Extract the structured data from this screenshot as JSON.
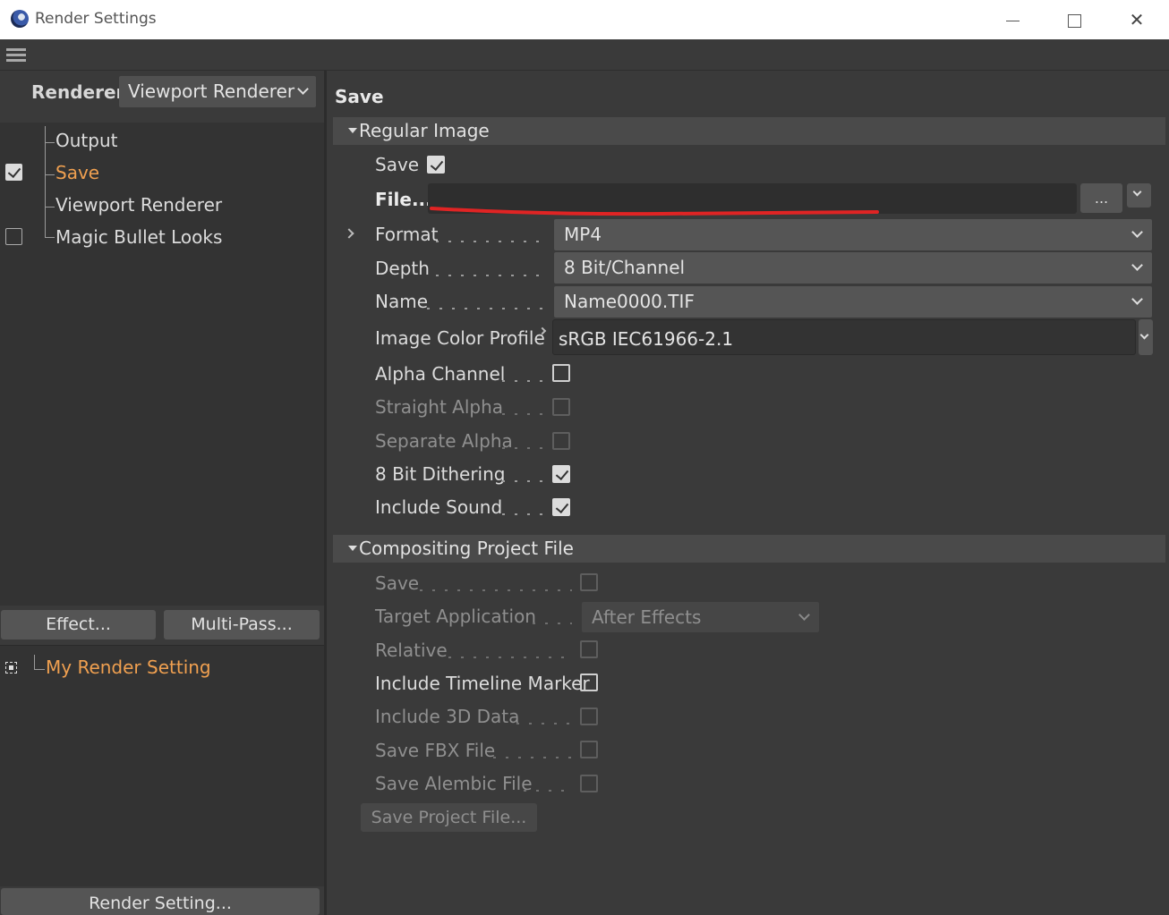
{
  "window": {
    "title": "Render Settings"
  },
  "left": {
    "renderer_label": "Renderer",
    "renderer_value": "Viewport Renderer",
    "tree": [
      {
        "label": "Output",
        "checked": null,
        "active": false
      },
      {
        "label": "Save",
        "checked": true,
        "active": true
      },
      {
        "label": "Viewport Renderer",
        "checked": null,
        "active": false
      },
      {
        "label": "Magic Bullet Looks",
        "checked": false,
        "active": false
      }
    ],
    "effect_button": "Effect...",
    "multipass_button": "Multi-Pass...",
    "render_setting_name": "My Render Setting",
    "render_setting_button": "Render Setting..."
  },
  "right": {
    "section_title": "Save",
    "regular_image": {
      "header": "Regular Image",
      "save_label": "Save",
      "save_checked": true,
      "file_label": "File...",
      "file_value": "",
      "browse_label": "...",
      "format_label": "Format",
      "format_value": "MP4",
      "depth_label": "Depth",
      "depth_value": "8 Bit/Channel",
      "name_label": "Name",
      "name_value": "Name0000.TIF",
      "color_profile_label": "Image Color Profile",
      "color_profile_value": "sRGB IEC61966-2.1",
      "alpha_channel_label": "Alpha Channel",
      "alpha_channel_checked": false,
      "straight_alpha_label": "Straight Alpha",
      "straight_alpha_checked": false,
      "separate_alpha_label": "Separate Alpha",
      "separate_alpha_checked": false,
      "dithering_label": "8 Bit Dithering",
      "dithering_checked": true,
      "include_sound_label": "Include Sound",
      "include_sound_checked": true
    },
    "compositing": {
      "header": "Compositing Project File",
      "save_label": "Save",
      "target_app_label": "Target Application",
      "target_app_value": "After Effects",
      "relative_label": "Relative",
      "timeline_marker_label": "Include Timeline Marker",
      "include_3d_label": "Include 3D Data",
      "save_fbx_label": "Save FBX File",
      "save_alembic_label": "Save Alembic File",
      "save_project_button": "Save Project File..."
    }
  },
  "colors": {
    "accent_orange": "#f0a050",
    "panel_bg": "#3a3a3a",
    "annotation_red": "#e02424"
  }
}
